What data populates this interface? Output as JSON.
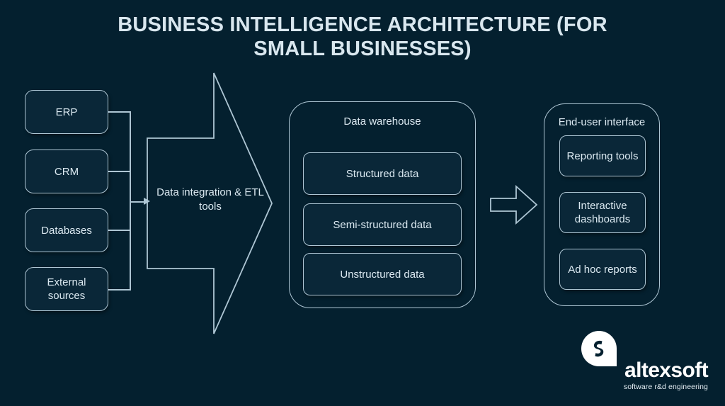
{
  "page": {
    "title": "BUSINESS INTELLIGENCE ARCHITECTURE (FOR SMALL BUSINESSES)",
    "background_color": "#04202f",
    "line_color": "#aec6d4",
    "node_fill": "#0a2738",
    "text_color": "#dbe9f1"
  },
  "sources": {
    "items": [
      {
        "label": "ERP"
      },
      {
        "label": "CRM"
      },
      {
        "label": "Databases"
      },
      {
        "label": "External sources"
      }
    ]
  },
  "etl": {
    "label": "Data integration & ETL tools",
    "shape": "right-block-arrow"
  },
  "data_warehouse": {
    "title": "Data warehouse",
    "items": [
      {
        "label": "Structured data"
      },
      {
        "label": "Semi-structured data"
      },
      {
        "label": "Unstructured data"
      }
    ]
  },
  "flow_arrow": {
    "name": "right-arrow-icon"
  },
  "end_user_interface": {
    "title": "End-user interface",
    "items": [
      {
        "label": "Reporting tools"
      },
      {
        "label": "Interactive dashboards"
      },
      {
        "label": "Ad hoc reports"
      }
    ]
  },
  "logo": {
    "wordmark": "altexsoft",
    "tagline": "software r&d engineering",
    "mark_color": "#ffffff"
  }
}
